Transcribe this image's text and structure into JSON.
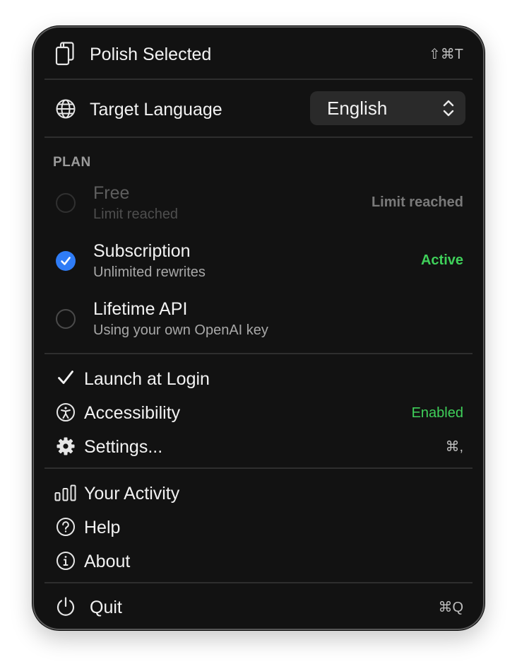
{
  "menu": {
    "polish": {
      "label": "Polish Selected",
      "shortcut": "⇧⌘T",
      "icon": "document-copy-icon"
    },
    "target_language": {
      "label": "Target Language",
      "value": "English",
      "icon": "globe-icon"
    },
    "plan": {
      "heading": "PLAN",
      "options": [
        {
          "title": "Free",
          "subtitle": "Limit reached",
          "status": "Limit reached",
          "selected": false,
          "enabled": false
        },
        {
          "title": "Subscription",
          "subtitle": "Unlimited rewrites",
          "status": "Active",
          "selected": true,
          "enabled": true
        },
        {
          "title": "Lifetime API",
          "subtitle": "Using your own OpenAI key",
          "status": "",
          "selected": false,
          "enabled": true
        }
      ]
    },
    "launch_at_login": {
      "label": "Launch at Login",
      "checked": true,
      "icon": "checkmark-icon"
    },
    "accessibility": {
      "label": "Accessibility",
      "status": "Enabled",
      "icon": "accessibility-icon"
    },
    "settings": {
      "label": "Settings...",
      "shortcut": "⌘,",
      "icon": "gear-icon"
    },
    "activity": {
      "label": "Your Activity",
      "icon": "bar-chart-icon"
    },
    "help": {
      "label": "Help",
      "icon": "question-circle-icon"
    },
    "about": {
      "label": "About",
      "icon": "info-circle-icon"
    },
    "quit": {
      "label": "Quit",
      "shortcut": "⌘Q",
      "icon": "power-icon"
    }
  },
  "colors": {
    "background": "#121212",
    "accent": "#2f7cf6",
    "status_green": "#3fd05a",
    "text": "#f2f2f2",
    "muted": "#a8a8a8"
  }
}
